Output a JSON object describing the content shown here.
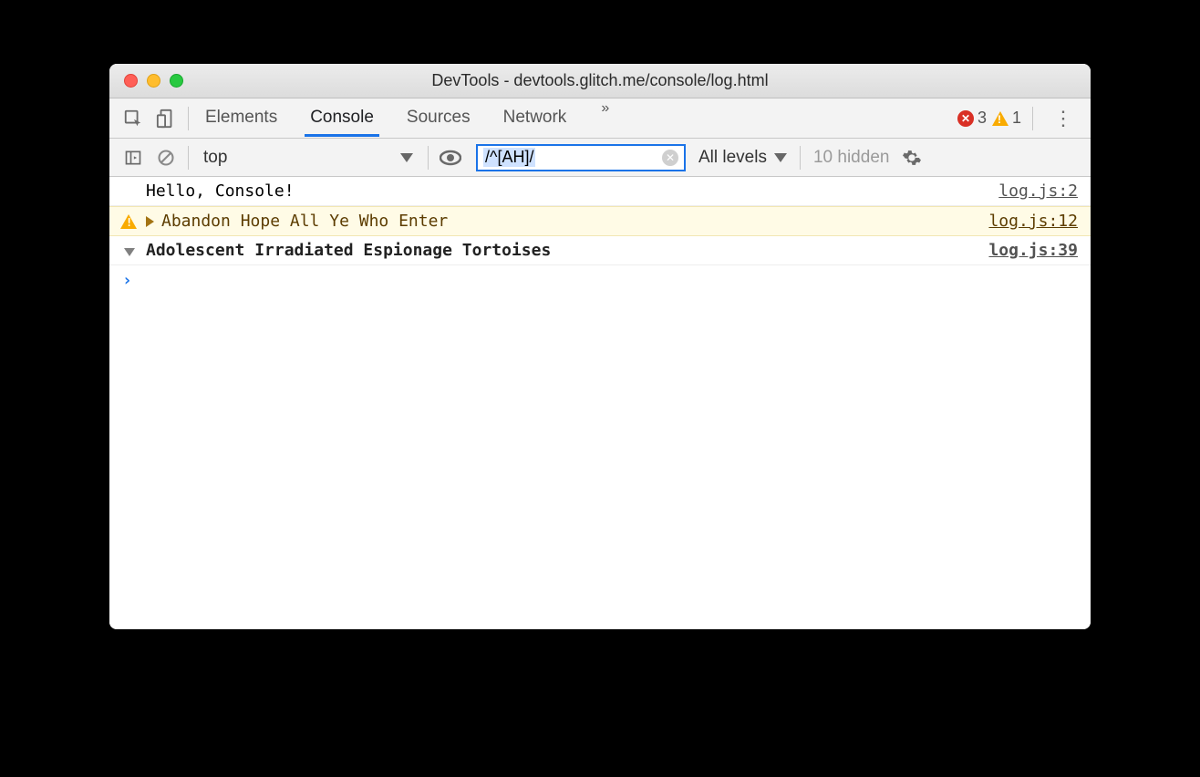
{
  "window": {
    "title": "DevTools - devtools.glitch.me/console/log.html"
  },
  "tabs": {
    "items": [
      "Elements",
      "Console",
      "Sources",
      "Network"
    ],
    "active": "Console",
    "overflow_glyph": "»"
  },
  "counters": {
    "error_count": "3",
    "warning_count": "1"
  },
  "console_toolbar": {
    "context": "top",
    "filter_value": "/^[AH]/",
    "levels_label": "All levels",
    "hidden_label": "10 hidden"
  },
  "messages": [
    {
      "type": "log",
      "text": "Hello, Console!",
      "source": "log.js:2"
    },
    {
      "type": "warn",
      "text": "Abandon Hope All Ye Who Enter",
      "source": "log.js:12"
    },
    {
      "type": "group",
      "text": "Adolescent Irradiated Espionage Tortoises",
      "source": "log.js:39"
    }
  ],
  "prompt_glyph": "›"
}
